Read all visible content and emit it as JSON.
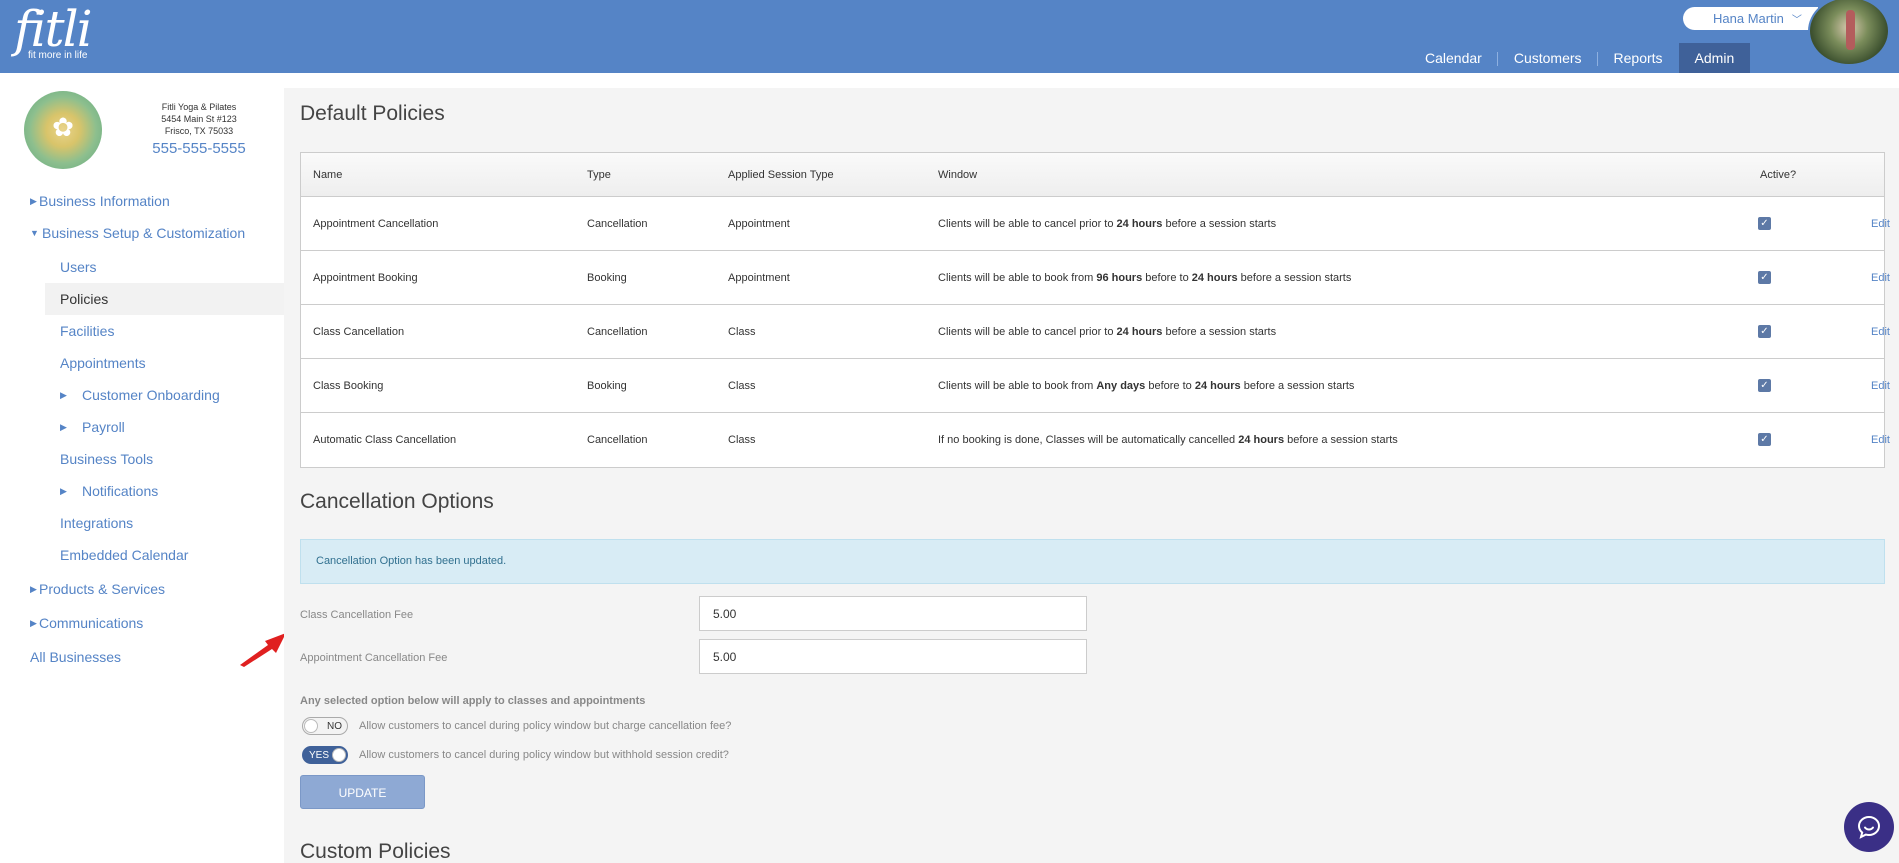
{
  "header": {
    "logo": "fitli",
    "tagline": "fit more in life",
    "user_name": "Hana Martin",
    "nav": [
      "Calendar",
      "Customers",
      "Reports",
      "Admin"
    ],
    "active_nav": "Admin"
  },
  "business": {
    "name": "Fitli Yoga & Pilates",
    "address1": "5454 Main St #123",
    "address2": "Frisco, TX 75033",
    "phone": "555-555-5555"
  },
  "sidebar": {
    "items": [
      {
        "label": "Business Information"
      },
      {
        "label": "Business Setup & Customization"
      },
      {
        "label": "Users"
      },
      {
        "label": "Policies"
      },
      {
        "label": "Facilities"
      },
      {
        "label": "Appointments"
      },
      {
        "label": "Customer Onboarding"
      },
      {
        "label": "Payroll"
      },
      {
        "label": "Business Tools"
      },
      {
        "label": "Notifications"
      },
      {
        "label": "Integrations"
      },
      {
        "label": "Embedded Calendar"
      },
      {
        "label": "Products & Services"
      },
      {
        "label": "Communications"
      },
      {
        "label": "All Businesses"
      }
    ]
  },
  "default_policies": {
    "title": "Default Policies",
    "columns": [
      "Name",
      "Type",
      "Applied Session Type",
      "Window",
      "Active?"
    ],
    "edit_label": "Edit",
    "rows": [
      {
        "name": "Appointment Cancellation",
        "type": "Cancellation",
        "session": "Appointment",
        "w1": "Clients will be able to cancel prior to ",
        "b1": "24 hours",
        "w2": " before a session starts",
        "b2": "",
        "w3": ""
      },
      {
        "name": "Appointment Booking",
        "type": "Booking",
        "session": "Appointment",
        "w1": "Clients will be able to book from ",
        "b1": "96 hours",
        "w2": " before to ",
        "b2": "24 hours",
        "w3": " before a session starts"
      },
      {
        "name": "Class Cancellation",
        "type": "Cancellation",
        "session": "Class",
        "w1": "Clients will be able to cancel prior to ",
        "b1": "24 hours",
        "w2": " before a session starts",
        "b2": "",
        "w3": ""
      },
      {
        "name": "Class Booking",
        "type": "Booking",
        "session": "Class",
        "w1": "Clients will be able to book from ",
        "b1": "Any days",
        "w2": " before to ",
        "b2": "24 hours",
        "w3": " before a session starts"
      },
      {
        "name": "Automatic Class Cancellation",
        "type": "Cancellation",
        "session": "Class",
        "w1": "If no booking is done, Classes will be automatically cancelled ",
        "b1": "24 hours",
        "w2": " before a session starts",
        "b2": "",
        "w3": ""
      }
    ]
  },
  "cancellation_options": {
    "title": "Cancellation Options",
    "alert": "Cancellation Option has been updated.",
    "class_fee_label": "Class Cancellation Fee",
    "class_fee_value": "5.00",
    "appt_fee_label": "Appointment Cancellation Fee",
    "appt_fee_value": "5.00",
    "note": "Any selected option below will apply to classes and appointments",
    "toggle1_state": "NO",
    "toggle1_label": "Allow customers to cancel during policy window but charge cancellation fee?",
    "toggle2_state": "YES",
    "toggle2_label": "Allow customers to cancel during policy window but withhold session credit?",
    "update_label": "UPDATE"
  },
  "custom_policies": {
    "title": "Custom Policies"
  },
  "colors": {
    "brand": "#5584c6",
    "nav_active": "#3f6199",
    "alert_bg": "#d8ecf5"
  }
}
